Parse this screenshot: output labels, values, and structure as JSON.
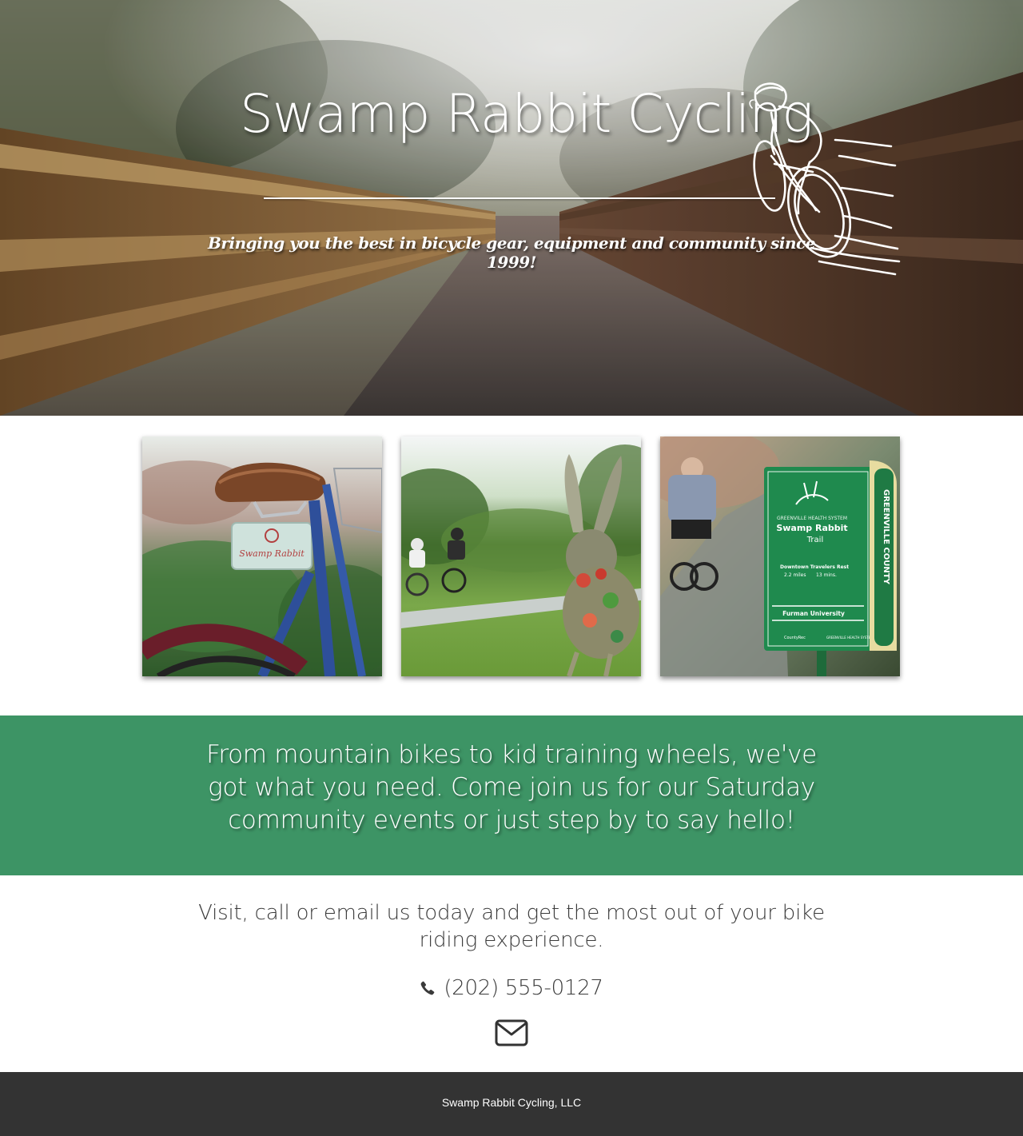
{
  "hero": {
    "title": "Swamp Rabbit Cycling",
    "tagline": "Bringing you the best in bicycle gear, equipment and community since 1999!",
    "logo_icon": "cyclist-sketch-icon"
  },
  "photos": [
    {
      "name": "photo-bike-saddle-tag",
      "tag_text": "Swamp Rabbit"
    },
    {
      "name": "photo-rabbit-sculpture"
    },
    {
      "name": "photo-trail-sign",
      "sign": {
        "system": "GREENVILLE HEALTH SYSTEM",
        "title": "Swamp Rabbit",
        "subtitle": "Trail",
        "direction": "Downtown Travelers Rest",
        "distance": "2.2 miles",
        "time": "13 mins.",
        "location": "Furman University",
        "county": "GREENVILLE COUNTY",
        "sponsor_1": "CountyRec",
        "sponsor_2": "GREENVILLE HEALTH SYSTEM"
      }
    }
  ],
  "promo": {
    "text": "From mountain bikes to kid training wheels, we've got what you need. Come join us for our Saturday community events or just step by to say hello!"
  },
  "contact": {
    "text": "Visit, call or email us today and get the most out of your bike riding experience.",
    "phone": "(202) 555-0127",
    "phone_icon": "phone-icon",
    "email_icon": "envelope-icon"
  },
  "footer": {
    "text": "Swamp Rabbit Cycling, LLC"
  },
  "colors": {
    "promo_green": "#3d9465",
    "footer_dark": "#333333",
    "text_dark": "#3a3a3a"
  }
}
